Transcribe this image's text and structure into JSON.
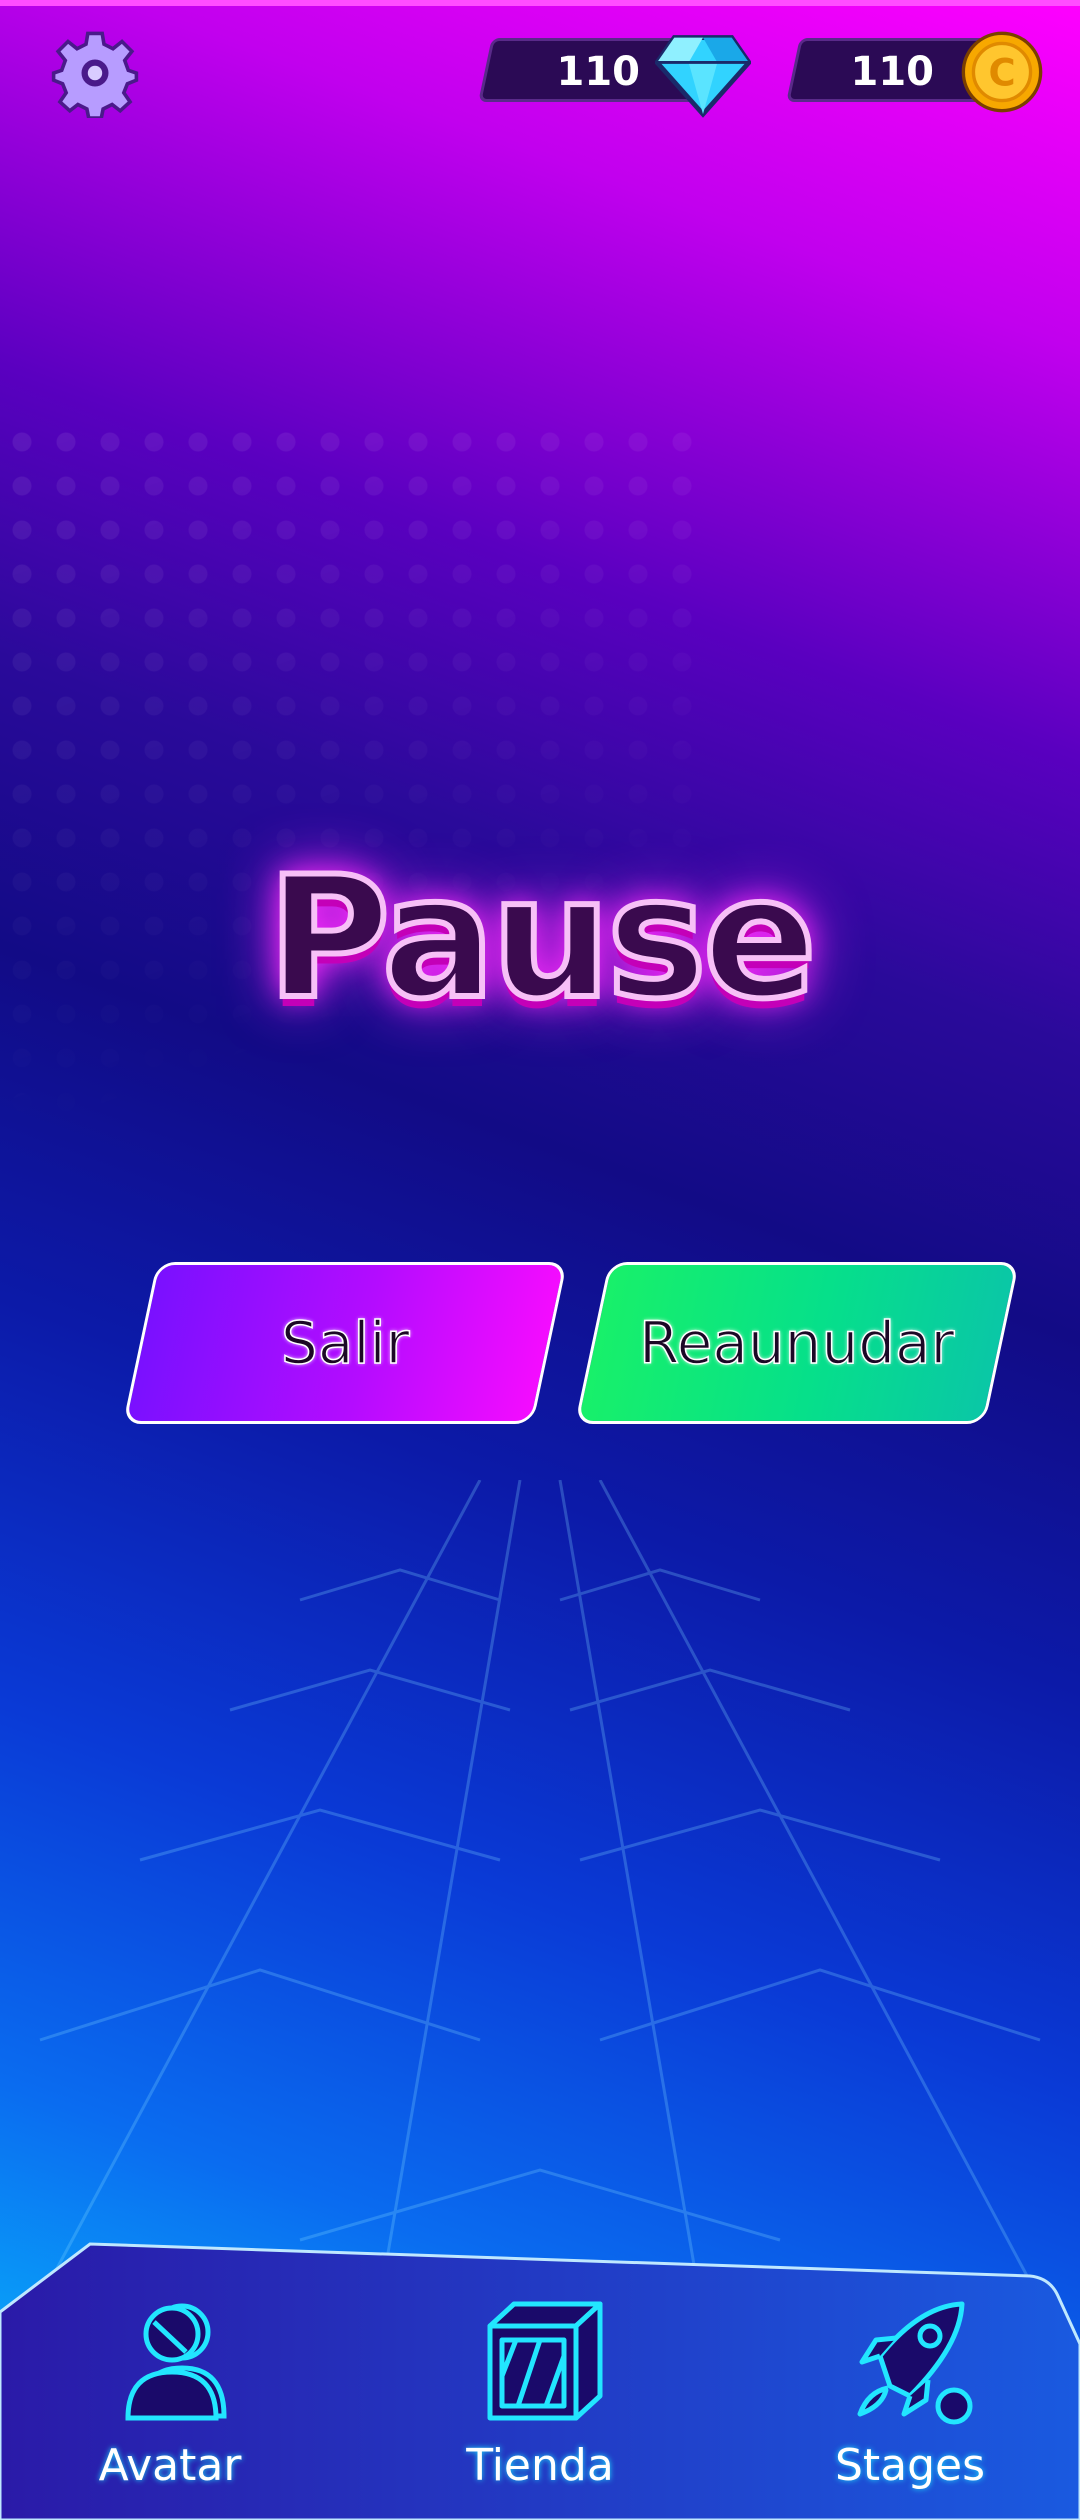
{
  "hud": {
    "settings_icon": "gear-icon",
    "gems": {
      "value": "110",
      "icon": "diamond-icon"
    },
    "coins": {
      "value": "110",
      "icon": "coin-icon",
      "symbol": "C"
    }
  },
  "pause": {
    "title": "Pause",
    "exit_label": "Salir",
    "resume_label": "Reaunudar"
  },
  "nav": {
    "items": [
      {
        "label": "Avatar",
        "icon": "avatar-icon"
      },
      {
        "label": "Tienda",
        "icon": "shop-icon"
      },
      {
        "label": "Stages",
        "icon": "rocket-icon"
      }
    ]
  },
  "colors": {
    "accent_magenta": "#ff00ff",
    "exit_button": "#b40cff",
    "resume_button": "#06e08a",
    "nav_glow": "#1de0ff"
  }
}
